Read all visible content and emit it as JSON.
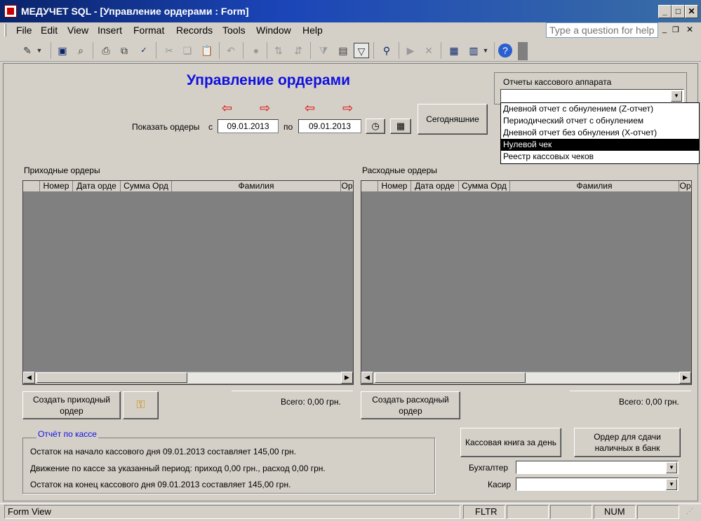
{
  "window": {
    "title": "МЕДУЧЕТ SQL - [Управление ордерами : Form]"
  },
  "menu": {
    "items": [
      "File",
      "Edit",
      "View",
      "Insert",
      "Format",
      "Records",
      "Tools",
      "Window",
      "Help"
    ],
    "help_placeholder": "Type a question for help"
  },
  "form": {
    "title": "Управление ордерами",
    "show_orders_label": "Показать ордеры",
    "from_label": "с",
    "to_label": "по",
    "date_from": "09.01.2013",
    "date_to": "09.01.2013",
    "today_button": "Сегодняшние",
    "arrow_left": "⇦",
    "arrow_right": "⇨"
  },
  "cash_reports": {
    "label": "Отчеты кассового аппарата",
    "options": [
      "Дневной отчет с обнулением (Z-отчет)",
      "Периодический отчет с обнулением",
      "Дневной отчет без обнуления (X-отчет)",
      "Нулевой чек",
      "Реестр кассовых чеков"
    ],
    "selected_index": 3
  },
  "incoming": {
    "label": "Приходные ордеры",
    "columns": [
      "Номер",
      "Дата орде",
      "Сумма Орд",
      "Фамилия",
      "Ор"
    ],
    "total": "Всего: 0,00 грн.",
    "create_button": "Создать приходный ордер"
  },
  "outgoing": {
    "label": "Расходные ордеры",
    "columns": [
      "Номер",
      "Дата орде",
      "Сумма Орд",
      "Фамилия",
      "Ор"
    ],
    "total": "Всего: 0,00 грн.",
    "create_button": "Создать расходный ордер"
  },
  "report": {
    "legend": "Отчёт по кассе",
    "line1": "Остаток на начало кассового дня 09.01.2013 составляет 145,00 грн.",
    "line2": "Движение по кассе за указанный период: приход 0,00 грн., расход 0,00 грн.",
    "line3": "Остаток на конец кассового дня 09.01.2013 составляет 145,00 грн."
  },
  "buttons": {
    "cash_book": "Кассовая книга за день",
    "bank_order": "Ордер для сдачи наличных в банк"
  },
  "staff": {
    "accountant_label": "Бухгалтер",
    "cashier_label": "Касир"
  },
  "status": {
    "view": "Form View",
    "filter": "FLTR",
    "num": "NUM"
  },
  "colors": {
    "title_blue": "#1010e0",
    "arrow_red": "#e00000",
    "grid_bg": "#808080"
  }
}
